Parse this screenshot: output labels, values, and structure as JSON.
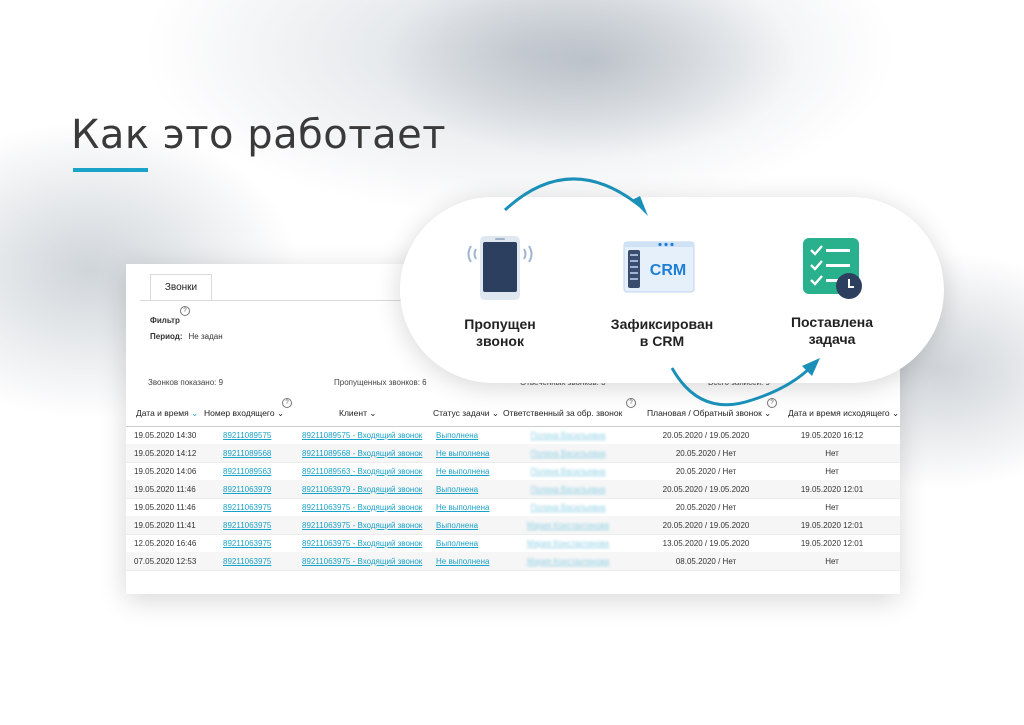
{
  "heading": "Как это работает",
  "colors": {
    "accent": "#1aa3c9",
    "crm_blue": "#1f7fd6",
    "task_green": "#28b18c",
    "phone_dark": "#2d3f5e"
  },
  "steps": [
    {
      "icon": "smartphone-icon",
      "line1": "Пропущен",
      "line2": "звонок"
    },
    {
      "icon": "crm-server-icon",
      "icon_text": "CRM",
      "line1": "Зафиксирован",
      "line2": "в CRM"
    },
    {
      "icon": "task-checklist-icon",
      "line1": "Поставлена",
      "line2": "задача"
    }
  ],
  "crm_panel": {
    "tab": "Звонки",
    "filter_label": "Фильтр",
    "period_label": "Период:",
    "period_value": "Не задан",
    "stats": [
      "Звонков показано: 9",
      "Пропущенных звонков: 6",
      "Отвеченных звонков: 3",
      "Всего записей: 9"
    ],
    "columns": [
      "Дата и время",
      "Номер входящего",
      "Клиент",
      "Статус задачи",
      "Ответственный за обр. звонок",
      "Плановая / Обратный звонок",
      "Дата и время исходящего"
    ],
    "rows": [
      [
        "19.05.2020 14:30",
        "89211089575",
        "89211089575 - Входящий звонок",
        "Выполнена",
        "Полина Васильевна",
        "20.05.2020 / 19.05.2020",
        "19.05.2020 16:12"
      ],
      [
        "19.05.2020 14:12",
        "89211089568",
        "89211089568 - Входящий звонок",
        "Не выполнена",
        "Полина Васильевна",
        "20.05.2020 / Нет",
        "Нет"
      ],
      [
        "19.05.2020 14:06",
        "89211089563",
        "89211089563 - Входящий звонок",
        "Не выполнена",
        "Полина Васильевна",
        "20.05.2020 / Нет",
        "Нет"
      ],
      [
        "19.05.2020 11:46",
        "89211063979",
        "89211063979 - Входящий звонок",
        "Выполнена",
        "Полина Васильевна",
        "20.05.2020 / 19.05.2020",
        "19.05.2020 12:01"
      ],
      [
        "19.05.2020 11:46",
        "89211063975",
        "89211063975 - Входящий звонок",
        "Не выполнена",
        "Полина Васильевна",
        "20.05.2020 / Нет",
        "Нет"
      ],
      [
        "19.05.2020 11:41",
        "89211063975",
        "89211063975 - Входящий звонок",
        "Выполнена",
        "Мария Константинова",
        "20.05.2020 / 19.05.2020",
        "19.05.2020 12:01"
      ],
      [
        "12.05.2020 16:46",
        "89211063975",
        "89211063975 - Входящий звонок",
        "Выполнена",
        "Мария Константинова",
        "13.05.2020 / 19.05.2020",
        "19.05.2020 12:01"
      ],
      [
        "07.05.2020 12:53",
        "89211063975",
        "89211063975 - Входящий звонок",
        "Не выполнена",
        "Мария Константинова",
        "08.05.2020 / Нет",
        "Нет"
      ]
    ]
  }
}
